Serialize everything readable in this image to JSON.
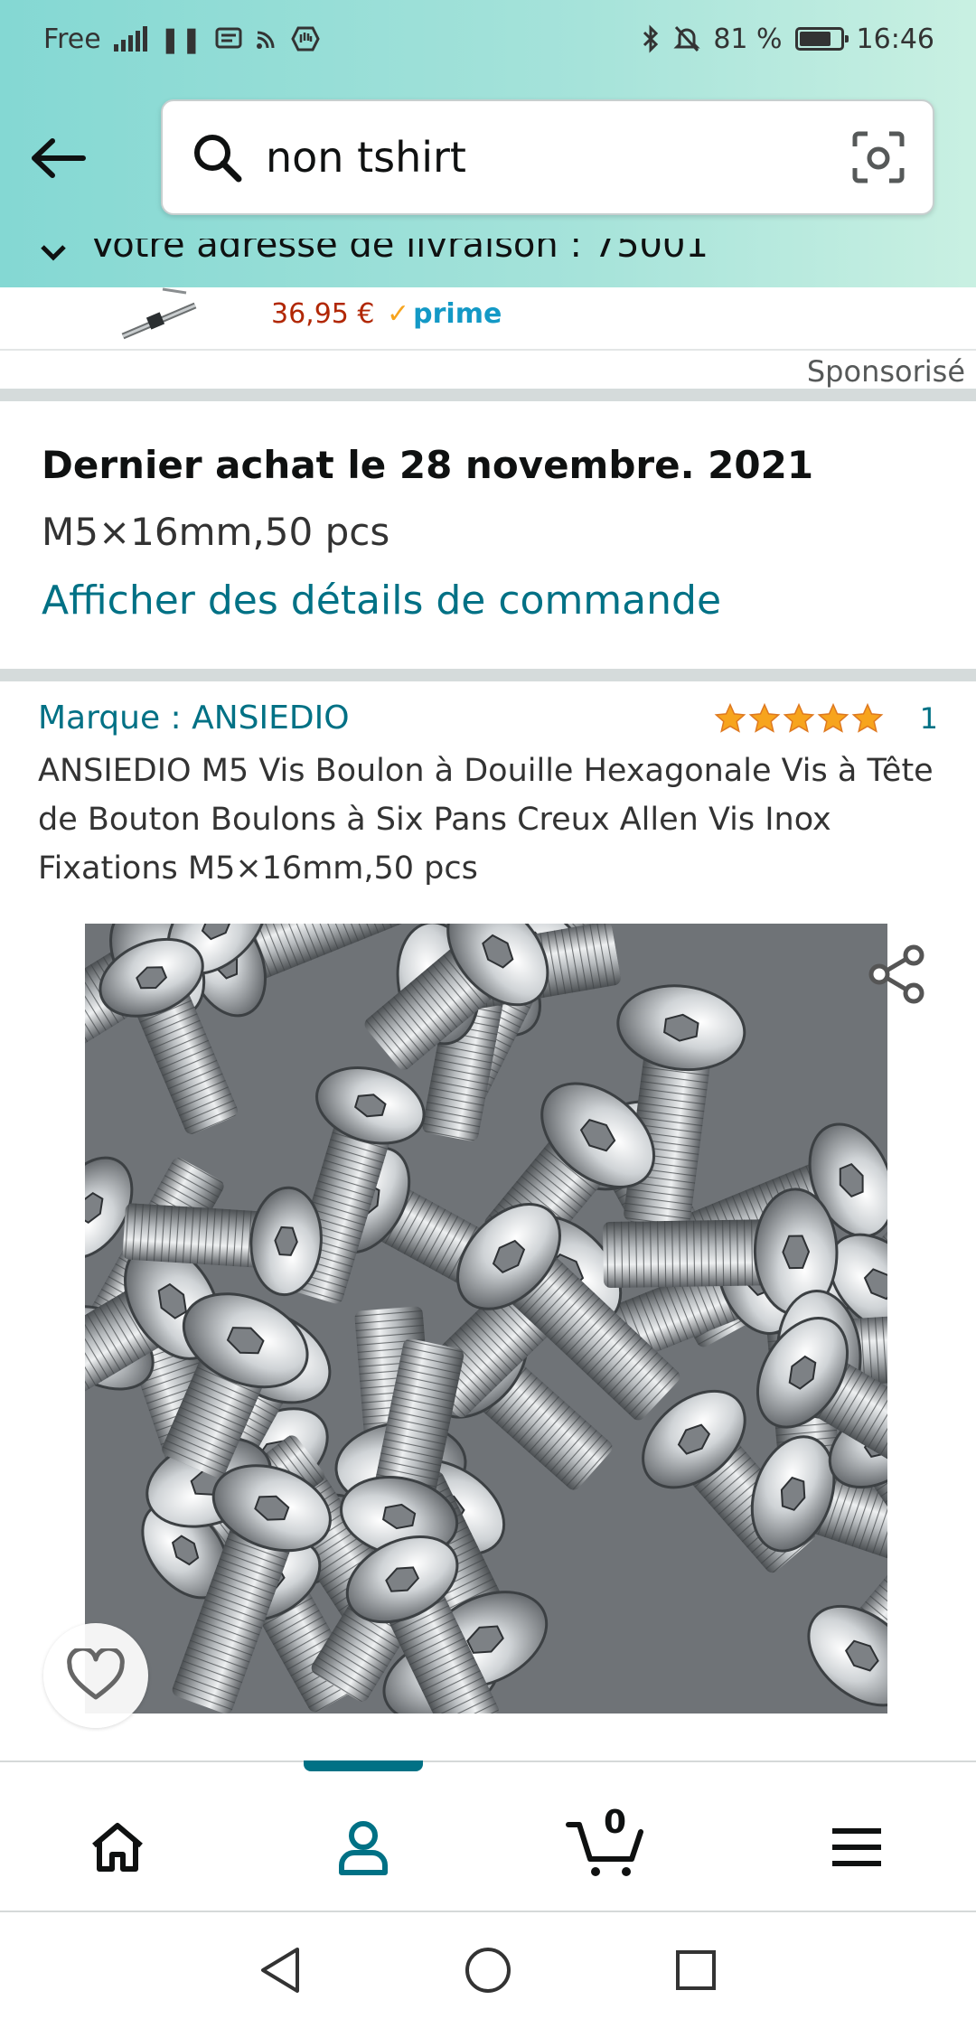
{
  "status_bar": {
    "carrier": "Free",
    "battery_text": "81 %",
    "battery_level_percent": 81,
    "time": "16:46",
    "icons": [
      "signal-icon",
      "pause-icon",
      "message-icon",
      "cast-icon",
      "hand-icon",
      "bluetooth-icon",
      "mute-icon",
      "battery-icon"
    ]
  },
  "search": {
    "query": "non tshirt",
    "icons": [
      "back-arrow-icon",
      "search-icon",
      "camera-scan-icon"
    ]
  },
  "delivery": {
    "text": "Votre adresse de livraison : 75001"
  },
  "sponsored_product": {
    "price": "36,95 €",
    "prime_label": "prime",
    "sponsored_label": "Sponsorisé"
  },
  "purchase": {
    "title": "Dernier achat le 28 novembre. 2021",
    "variant": "M5×16mm,50 pcs",
    "details_link": "Afficher des détails de commande"
  },
  "product": {
    "brand": "Marque : ANSIEDIO",
    "rating_stars": 5,
    "rating_count": "1",
    "title": "ANSIEDIO M5 Vis Boulon à Douille Hexagonale Vis à Tête de Bouton Boulons à Six Pans Creux Allen Vis Inox Fixations M5×16mm,50 pcs",
    "image_subject": "pile of stainless steel button head hex socket screws",
    "icons": [
      "share-icon",
      "heart-icon"
    ]
  },
  "bottom_nav": {
    "items": [
      {
        "name": "home",
        "icon": "home-icon",
        "active": false
      },
      {
        "name": "account",
        "icon": "user-icon",
        "active": true
      },
      {
        "name": "cart",
        "icon": "cart-icon",
        "active": false
      },
      {
        "name": "menu",
        "icon": "hamburger-menu-icon",
        "active": false
      }
    ],
    "cart_count": "0",
    "accent_color": "#007185"
  },
  "colors": {
    "link": "#007185",
    "price": "#b12704",
    "prime_blue": "#1399c6",
    "star_orange": "#f7a41d",
    "header_gradient_start": "#84d8d3",
    "header_gradient_end": "#c9f0e2"
  }
}
